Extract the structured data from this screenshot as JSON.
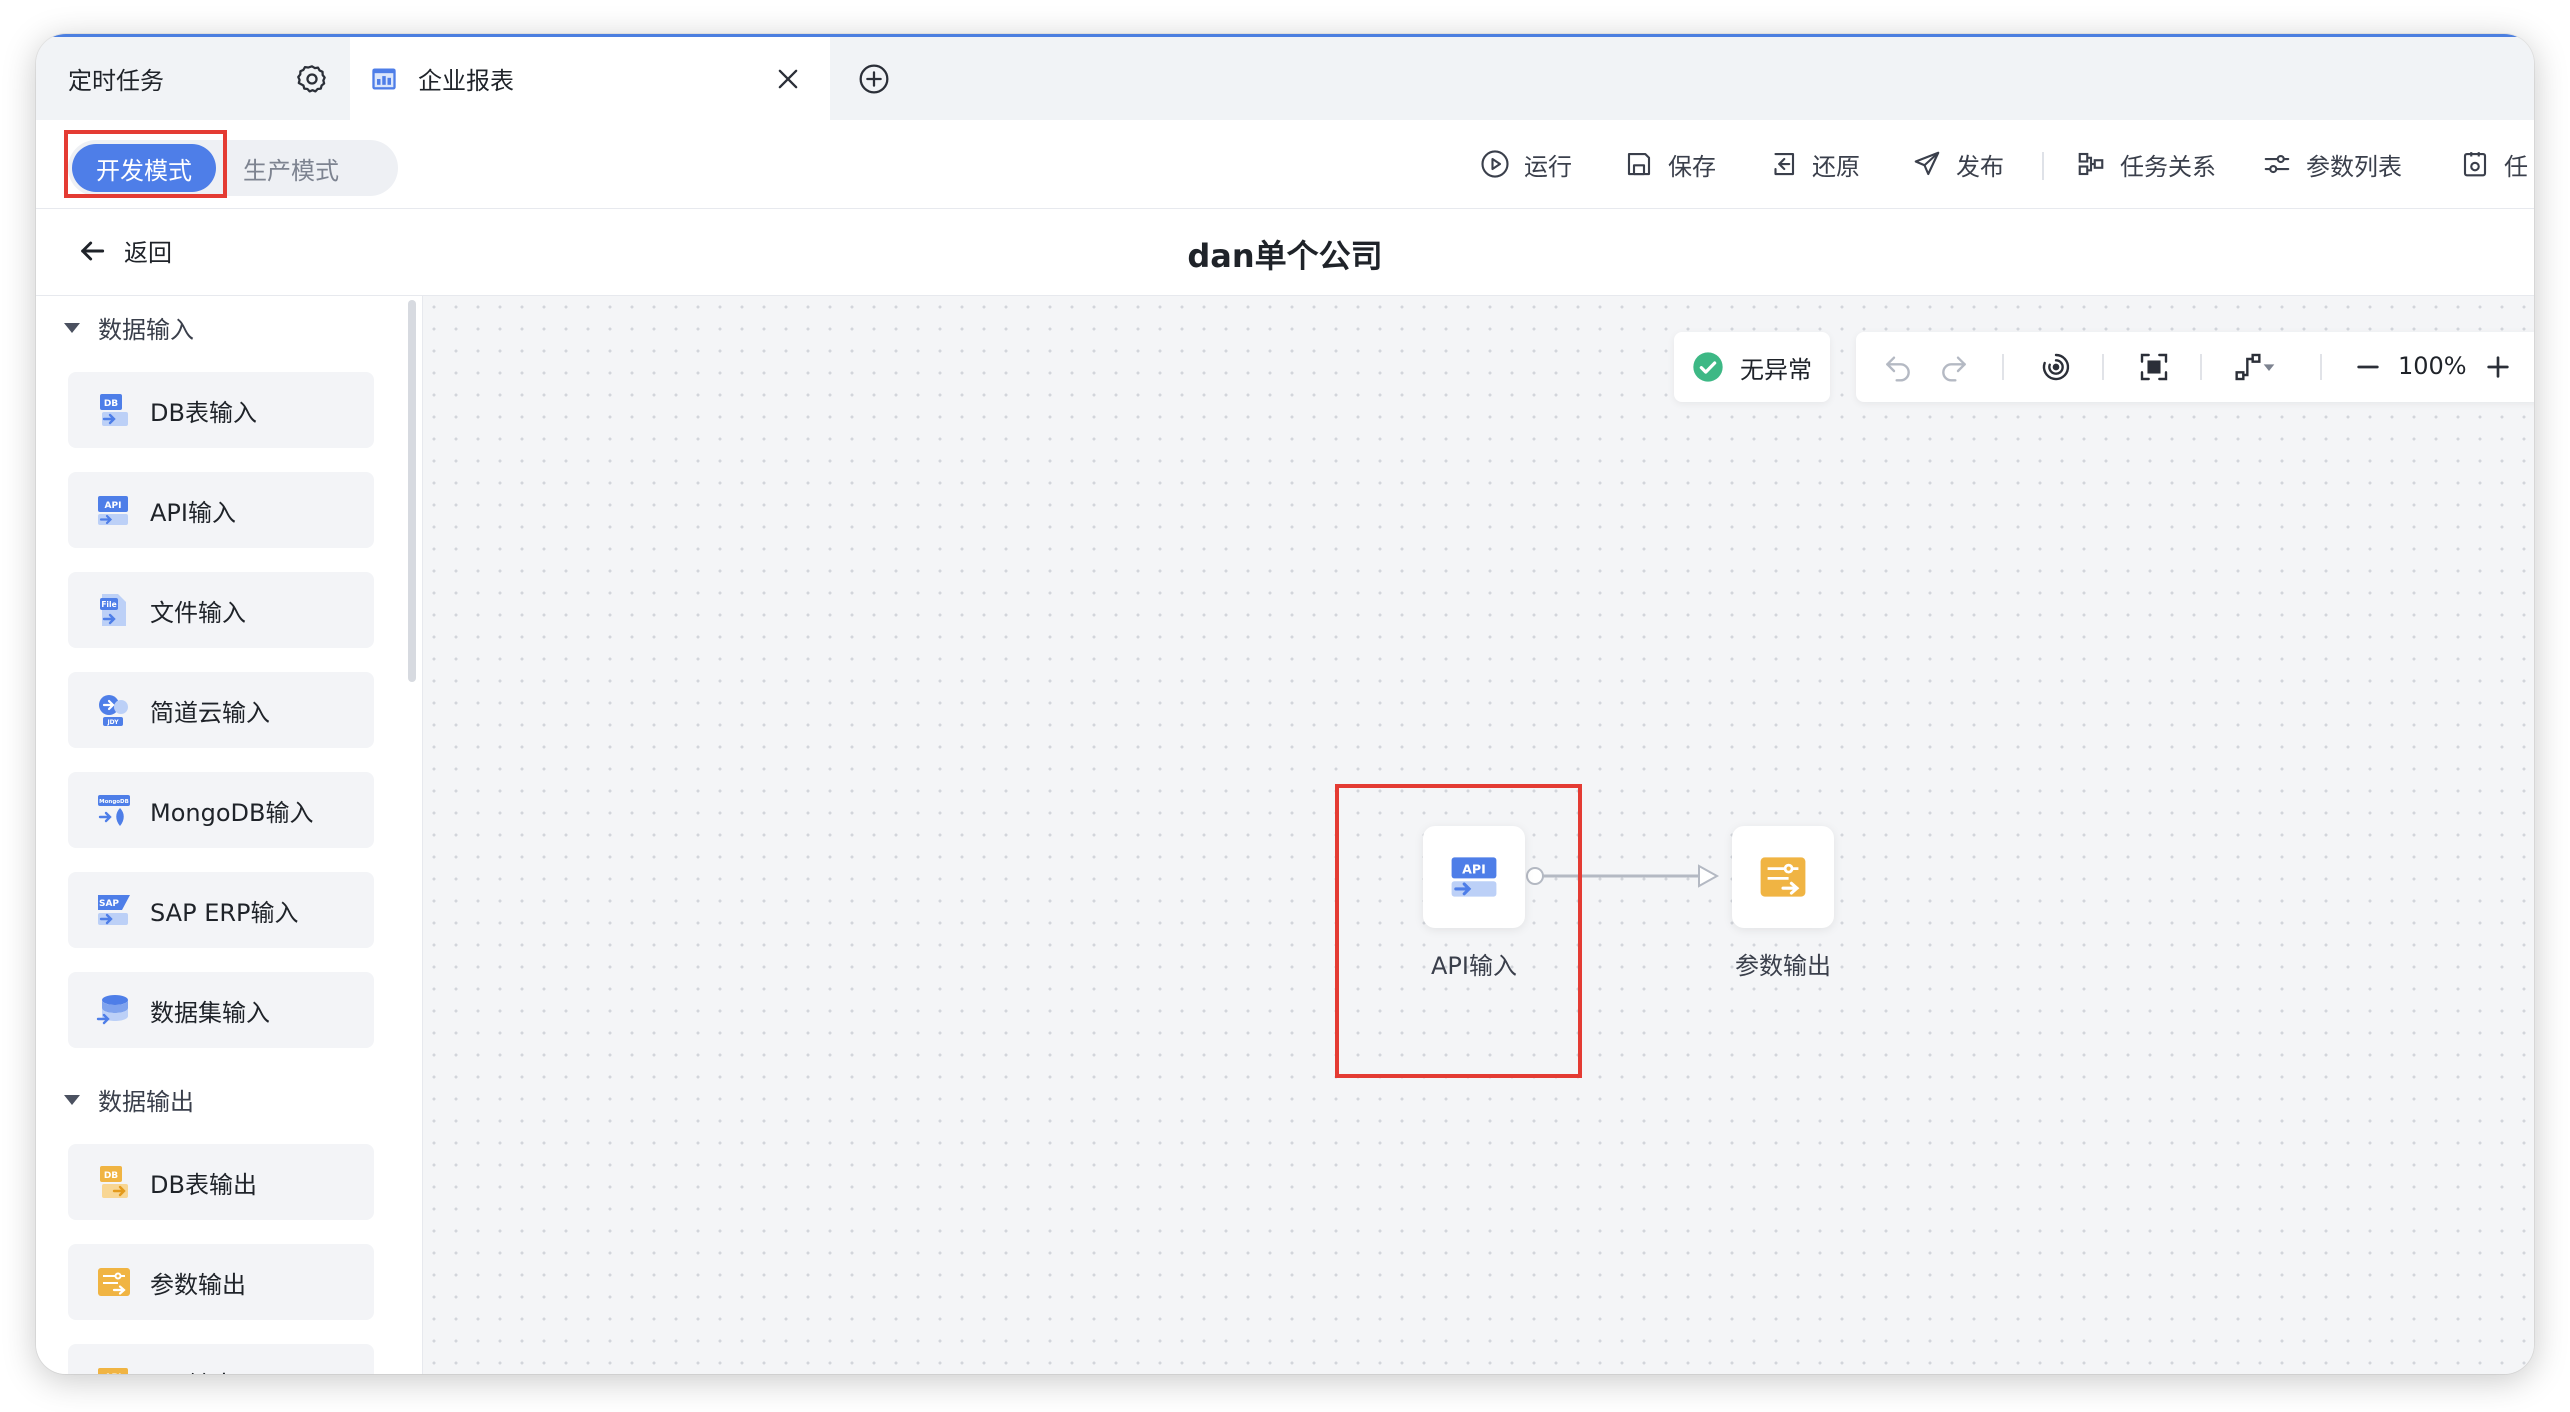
{
  "tabs": [
    {
      "label": "定时任务",
      "icon": "gear-icon"
    },
    {
      "label": "企业报表",
      "icon": "report-icon",
      "active": true
    }
  ],
  "modes": {
    "dev": "开发模式",
    "prod": "生产模式",
    "selected": "开发模式"
  },
  "toolbar": {
    "run": "运行",
    "save": "保存",
    "restore": "还原",
    "publish": "发布",
    "relations": "任务关系",
    "params": "参数列表",
    "more": "任"
  },
  "header": {
    "back": "返回",
    "title": "dan单个公司"
  },
  "sidebar": {
    "input_section": "数据输入",
    "input_items": [
      {
        "label": "DB表输入",
        "icon": "db-input-icon"
      },
      {
        "label": "API输入",
        "icon": "api-input-icon"
      },
      {
        "label": "文件输入",
        "icon": "file-input-icon"
      },
      {
        "label": "简道云输入",
        "icon": "jdy-input-icon"
      },
      {
        "label": "MongoDB输入",
        "icon": "mongodb-input-icon"
      },
      {
        "label": "SAP ERP输入",
        "icon": "sap-input-icon"
      },
      {
        "label": "数据集输入",
        "icon": "dataset-input-icon"
      }
    ],
    "output_section": "数据输出",
    "output_items": [
      {
        "label": "DB表输出",
        "icon": "db-output-icon"
      },
      {
        "label": "参数输出",
        "icon": "param-output-icon"
      },
      {
        "label": "API输出",
        "icon": "api-output-icon"
      }
    ]
  },
  "canvas": {
    "status": "无异常",
    "zoom": "100%",
    "nodes": [
      {
        "label": "API输入",
        "icon": "api-input-icon"
      },
      {
        "label": "参数输出",
        "icon": "param-output-icon"
      }
    ]
  },
  "colors": {
    "accent": "#4e7ee8",
    "highlight": "#e43b33",
    "success": "#3db885",
    "output": "#f0b443"
  }
}
